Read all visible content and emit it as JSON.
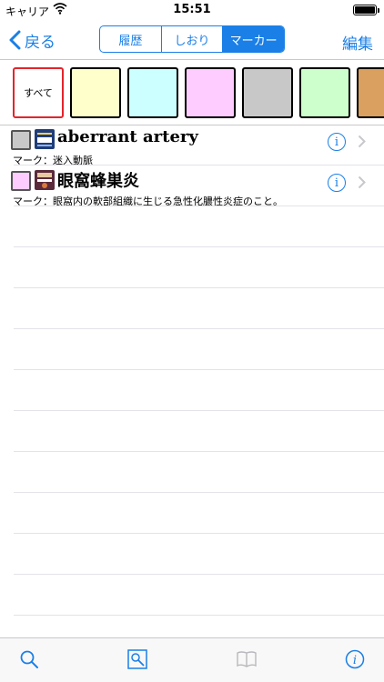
{
  "status_bar": {
    "carrier": "キャリア",
    "time": "15:51",
    "wifi_icon": "wifi-icon",
    "battery_icon": "battery-icon"
  },
  "navbar": {
    "back_label": "戻る",
    "segments": [
      {
        "label": "履歴",
        "active": false
      },
      {
        "label": "しおり",
        "active": false
      },
      {
        "label": "マーカー",
        "active": true
      }
    ],
    "edit_label": "編集",
    "accent_color": "#1a7fe6"
  },
  "color_filter": {
    "all_label": "すべて",
    "selected": "all",
    "swatch_colors": [
      "#ffffcc",
      "#ccffff",
      "#ffccff",
      "#c8c8c8",
      "#ccffcc",
      "#d9a060"
    ]
  },
  "entries": [
    {
      "marker_color": "#c8c8c8",
      "book_icon": "book-icon",
      "title": "aberrant artery",
      "note": "マーク：迷入動脈"
    },
    {
      "marker_color": "#ffccff",
      "book_icon": "book-icon",
      "title": "眼窩蜂巣炎",
      "note": "マーク：眼窩内の軟部組織に生じる急性化膿性炎症のこと。"
    }
  ],
  "tab_bar": {
    "icons": [
      "search-icon",
      "image-search-icon",
      "book-open-icon",
      "info-icon"
    ]
  }
}
